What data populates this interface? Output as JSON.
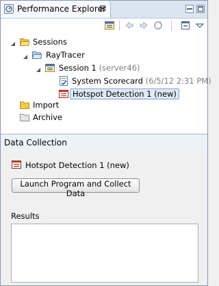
{
  "view": {
    "title": "Performance Explorer",
    "close_glyph": "⊠",
    "tab_icon": "performance-explorer-icon"
  },
  "toolbar": {
    "icons": [
      "session-icon",
      "back-arrow-icon",
      "forward-arrow-icon",
      "refresh-icon",
      "collapse-all-icon",
      "view-menu-icon"
    ]
  },
  "tree": {
    "sessions": "Sessions",
    "raytracer": "RayTracer",
    "session1": "Session 1",
    "session1_server": "(server46)",
    "scorecard": "System Scorecard",
    "scorecard_date": "(6/5/12 2:31 PM)",
    "hotspot": "Hotspot Detection 1 (new)",
    "import": "Import",
    "archive": "Archive"
  },
  "data_collection": {
    "title": "Data Collection",
    "activity": "Hotspot Detection 1 (new)",
    "launch_button": "Launch Program and Collect Data",
    "results_label": "Results",
    "results_text": ""
  },
  "colors": {
    "frame_border": "#8a98ad",
    "tab_bar": "#dbe4f1",
    "selection_fill": "#dfe9f7",
    "selection_border": "#7da2ce",
    "folder": "#f2c94c"
  }
}
